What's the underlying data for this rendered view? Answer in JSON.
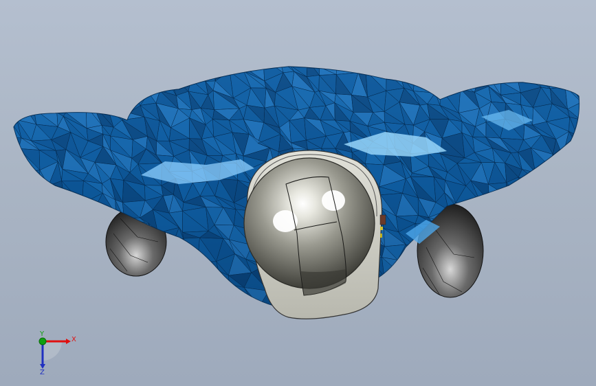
{
  "colors": {
    "background_top": "#b4bfcf",
    "background_bottom": "#9eaabc",
    "body_blue": "#0f5b9e",
    "body_dark": "#07396a",
    "highlight": "#9fd6ff",
    "mesh_line": "#062a4e",
    "wheel": "#2e2e2e",
    "sphere": "#a9a9a0",
    "housing": "#c9c9c0",
    "x_axis": "#e01010",
    "y_axis": "#10a010",
    "z_axis": "#2030c0"
  },
  "triad": {
    "x_label": "X",
    "y_label": "Y",
    "z_label": "Z"
  },
  "icons": {
    "model": "car-body-mesh-icon",
    "triad": "coordinate-triad-icon"
  }
}
